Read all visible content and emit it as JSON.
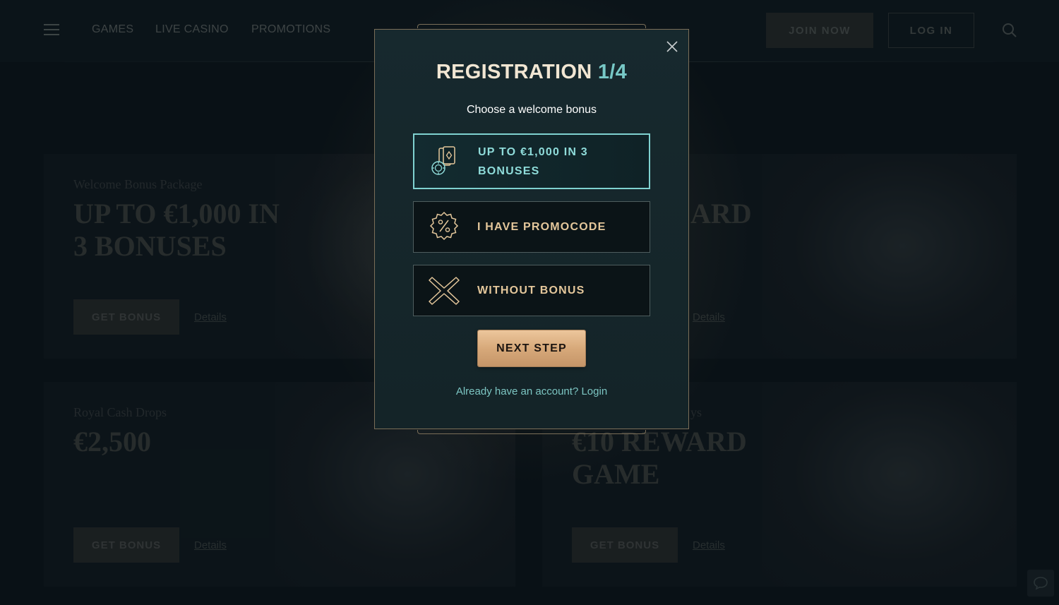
{
  "nav": {
    "items": [
      "GAMES",
      "LIVE CASINO",
      "PROMOTIONS"
    ],
    "join_label": "JOIN NOW",
    "login_label": "LOG IN"
  },
  "cards": [
    {
      "subtitle": "Welcome Bonus Package",
      "title": "UP TO €1,000 IN 3 BONUSES",
      "button": "GET BONUS",
      "link": "Details"
    },
    {
      "subtitle": "",
      "title": "ARD",
      "button": "",
      "link": "Details"
    },
    {
      "subtitle": "Royal Cash Drops",
      "title": "€2,500",
      "button": "GET BONUS",
      "link": "Details"
    },
    {
      "subtitle": "ys",
      "title": "€10 REWARD GAME",
      "button": "GET BONUS",
      "link": "Details"
    }
  ],
  "modal": {
    "title": "REGISTRATION",
    "step": "1/4",
    "subtitle": "Choose a welcome bonus",
    "options": [
      {
        "label": "UP TO €1,000 IN 3 BONUSES",
        "icon": "cards-chip-icon",
        "selected": true
      },
      {
        "label": "I HAVE PROMOCODE",
        "icon": "percent-badge-icon",
        "selected": false
      },
      {
        "label": "WITHOUT BONUS",
        "icon": "cross-icon",
        "selected": false
      }
    ],
    "next_label": "NEXT STEP",
    "login_prompt": "Already have an account?",
    "login_link": "Login"
  },
  "colors": {
    "accent_teal": "#7fd2d0",
    "gold": "#e4c79b",
    "modal_bg": "#17292e",
    "page_bg": "#0c161b"
  }
}
